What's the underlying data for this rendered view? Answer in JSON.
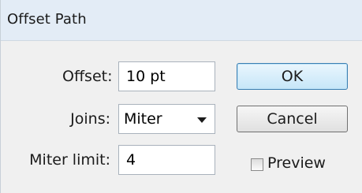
{
  "dialog": {
    "title": "Offset Path"
  },
  "fields": {
    "offset": {
      "label": "Offset:",
      "value": "10 pt"
    },
    "joins": {
      "label": "Joins:",
      "value": "Miter",
      "icon": "chevron-down-icon"
    },
    "miter_limit": {
      "label": "Miter limit:",
      "value": "4"
    }
  },
  "buttons": {
    "ok": "OK",
    "cancel": "Cancel"
  },
  "preview": {
    "label": "Preview",
    "checked": false
  },
  "colors": {
    "titlebar": "#e3ecf6",
    "dialog_bg": "#f0f0f0",
    "default_button_border": "#3c7fb1"
  }
}
